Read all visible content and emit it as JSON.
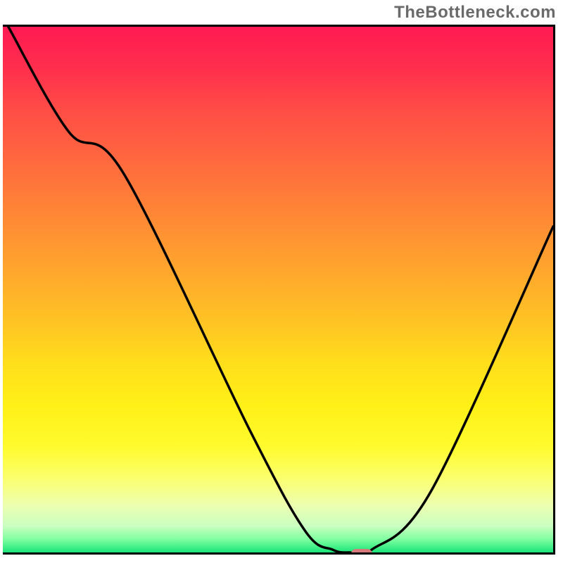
{
  "watermark": "TheBottleneck.com",
  "chart_data": {
    "type": "line",
    "title": "",
    "xlabel": "",
    "ylabel": "",
    "xlim": [
      0,
      100
    ],
    "ylim": [
      0,
      100
    ],
    "series": [
      {
        "name": "curve",
        "x": [
          1,
          12,
          22,
          45,
          55,
          60,
          63,
          67,
          78,
          100
        ],
        "y": [
          100,
          80,
          72,
          23,
          4,
          0.5,
          0,
          0.5,
          12,
          62
        ]
      }
    ],
    "marker": {
      "x": 65,
      "y": 0
    },
    "colors": {
      "top": "#ff1a53",
      "mid": "#ffde1c",
      "bottom": "#19e478",
      "curve": "#000000",
      "marker": "#d97a7a"
    }
  }
}
